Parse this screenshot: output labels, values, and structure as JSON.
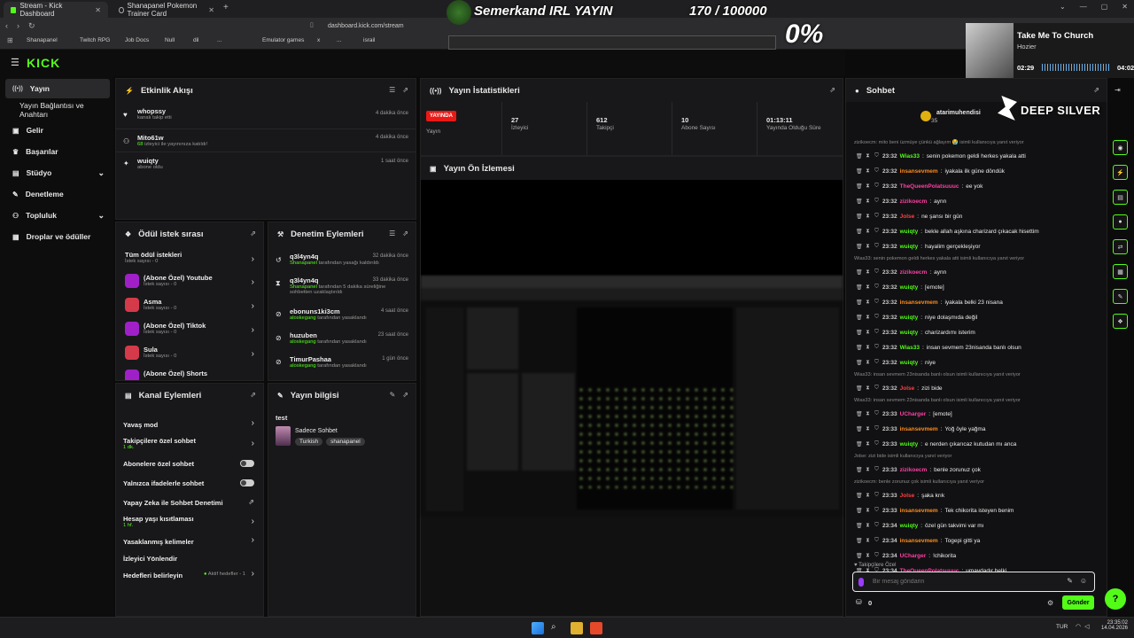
{
  "browser": {
    "tabs": [
      {
        "label": "Stream - Kick Dashboard"
      },
      {
        "label": "Shanapanel Pokemon Trainer Card"
      }
    ],
    "url": "dashboard.kick.com/stream",
    "bookmarks": [
      "Shanapanel",
      "Twitch RPG",
      "Job Docs",
      "Null",
      "dil",
      "...",
      "",
      "Emulator games",
      "x",
      "...",
      "israil"
    ]
  },
  "overlay": {
    "stream_title": "Semerkand IRL YAYIN",
    "goal": "170 / 100000",
    "percent": "0%",
    "sponsor": "DEEP SILVER",
    "music": {
      "title": "Take Me To Church",
      "artist": "Hozier",
      "elapsed": "02:29",
      "total": "04:02"
    }
  },
  "app": {
    "logo": "KICK",
    "sidebar": [
      {
        "label": "Yayın",
        "icon": "broadcast-icon"
      },
      {
        "label": "Yayın Bağlantısı ve Anahtarı",
        "icon": ""
      },
      {
        "label": "Gelir",
        "icon": "money-icon"
      },
      {
        "label": "Başarılar",
        "icon": "trophy-icon"
      },
      {
        "label": "Stüdyo",
        "icon": "studio-icon"
      },
      {
        "label": "Denetleme",
        "icon": "wrench-icon"
      },
      {
        "label": "Topluluk",
        "icon": "community-icon"
      },
      {
        "label": "Droplar ve ödüller",
        "icon": "gift-icon"
      }
    ]
  },
  "activity": {
    "title": "Etkinlik Akışı",
    "items": [
      {
        "name": "whopssy",
        "desc": "kanalı takip etti",
        "time": "4 dakika önce"
      },
      {
        "name": "Mito61w",
        "count": "68",
        "desc": " izleyici ile yayınınıza katıldı!",
        "time": "4 dakika önce"
      },
      {
        "name": "wuiqty",
        "desc": "abone oldu",
        "time": "1 saat önce"
      }
    ]
  },
  "stats": {
    "title": "Yayın İstatistikleri",
    "live_badge": "YAYINDA",
    "live_label": "Yayın",
    "cells": [
      {
        "value": "27",
        "label": "İzleyici"
      },
      {
        "value": "612",
        "label": "Takipçi"
      },
      {
        "value": "10",
        "label": "Abone Sayısı"
      },
      {
        "value": "01:13:11",
        "label": "Yayında Olduğu Süre"
      }
    ]
  },
  "preview": {
    "title": "Yayın Ön İzlemesi"
  },
  "rewards": {
    "title": "Ödül istek sırası",
    "all": {
      "title": "Tüm ödül istekleri",
      "sub": "İstek sayısı - 0"
    },
    "items": [
      {
        "title": "(Abone Özel) Youtube",
        "sub": "İstek sayısı - 0"
      },
      {
        "title": "Asma",
        "sub": "İstek sayısı - 0"
      },
      {
        "title": "(Abone Özel) Tiktok",
        "sub": "İstek sayısı - 0"
      },
      {
        "title": "Sula",
        "sub": "İstek sayısı - 0"
      },
      {
        "title": "(Abone Özel) Shorts",
        "sub": ""
      }
    ]
  },
  "moderation": {
    "title": "Denetim Eylemleri",
    "items": [
      {
        "name": "q3l4yn4q",
        "actor": "Shanapanel",
        "action": " tarafından yasağı kaldırıldı",
        "time": "32 dakika önce"
      },
      {
        "name": "q3l4yn4q",
        "actor": "Shanapanel",
        "action": " tarafından 5 dakika süreliğine sohbetten uzaklaştırıldı",
        "time": "33 dakika önce"
      },
      {
        "name": "ebonuns1ki3cm",
        "actor": "aloskegang",
        "action": " tarafından yasaklandı",
        "time": "4 saat önce"
      },
      {
        "name": "huzuben",
        "actor": "aloskegang",
        "action": " tarafından yasaklandı",
        "time": "23 saat önce"
      },
      {
        "name": "TimurPashaa",
        "actor": "aloskegang",
        "action": " tarafından yasaklandı",
        "time": "1 gün önce"
      }
    ]
  },
  "channel": {
    "title": "Kanal Eylemleri",
    "items": [
      {
        "label": "Yavaş mod",
        "sub": "",
        "control": "chevron"
      },
      {
        "label": "Takipçilere özel sohbet",
        "sub": "1 dk.",
        "control": "chevron"
      },
      {
        "label": "Abonelere özel sohbet",
        "sub": "",
        "control": "toggle"
      },
      {
        "label": "Yalnızca ifadelerle sohbet",
        "sub": "",
        "control": "toggle"
      },
      {
        "label": "Yapay Zeka ile Sohbet Denetimi",
        "sub": "",
        "control": "external"
      },
      {
        "label": "Hesap yaşı kısıtlaması",
        "sub": "1 hf.",
        "control": "chevron"
      },
      {
        "label": "Yasaklanmış kelimeler",
        "sub": "",
        "control": "chevron"
      },
      {
        "label": "İzleyici Yönlendir",
        "sub": "",
        "control": "none"
      },
      {
        "label": "Hedefleri belirleyin",
        "sub": "Aktif hedefler - 1",
        "control": "chevron"
      }
    ]
  },
  "info": {
    "title": "Yayın bilgisi",
    "stream_name": "test",
    "category": "Sadece Sohbet",
    "tags": [
      "Turkish",
      "shanapanel"
    ]
  },
  "chat": {
    "title": "Sohbet",
    "pinned_user": "atarimuhendisi",
    "pinned_count": "35",
    "lines": [
      {
        "type": "reply",
        "text": "zizikoecm: mito beni üzmüye çünkü ağlayım 😭 isimli kullanıcıya yanıt veriyor"
      },
      {
        "type": "msg",
        "time": "23:32",
        "user": "Wias33",
        "color": "#53fc18",
        "text": "senin pokemon geldi herkes yakala atti"
      },
      {
        "type": "msg",
        "time": "23:32",
        "user": "insansevmem",
        "color": "#ff8c1a",
        "text": "iyakala ilk güne döndük"
      },
      {
        "type": "msg",
        "time": "23:32",
        "user": "TheQueenPolatsuuuc",
        "color": "#ff3fa4",
        "text": "ee yok"
      },
      {
        "type": "msg",
        "time": "23:32",
        "user": "zizikoecm",
        "color": "#ff3fa4",
        "text": "aynn"
      },
      {
        "type": "msg",
        "time": "23:32",
        "user": "Jolse",
        "color": "#ff4040",
        "text": "ne şansı bir gün"
      },
      {
        "type": "msg",
        "time": "23:32",
        "user": "wuiqty",
        "color": "#53fc18",
        "text": "bekle allah aşkına charizard çıkacak hisettim"
      },
      {
        "type": "msg",
        "time": "23:32",
        "user": "wuiqty",
        "color": "#53fc18",
        "text": "hayalim gerçekleşiyor"
      },
      {
        "type": "reply",
        "text": "Wias33: senin pokemon geldi herkes yakala atti isimli kullanıcıya yanıt veriyor"
      },
      {
        "type": "msg",
        "time": "23:32",
        "user": "zizikoecm",
        "color": "#ff3fa4",
        "text": "aynn"
      },
      {
        "type": "msg",
        "time": "23:32",
        "user": "wuiqty",
        "color": "#53fc18",
        "text": "[emote]"
      },
      {
        "type": "msg",
        "time": "23:32",
        "user": "insansevmem",
        "color": "#ff8c1a",
        "text": "iyakala belki 23 nisana"
      },
      {
        "type": "msg",
        "time": "23:32",
        "user": "wuiqty",
        "color": "#53fc18",
        "text": "niye dolaşmıda değil"
      },
      {
        "type": "msg",
        "time": "23:32",
        "user": "wuiqty",
        "color": "#53fc18",
        "text": "charizardımı isterim"
      },
      {
        "type": "msg",
        "time": "23:32",
        "user": "Wias33",
        "color": "#53fc18",
        "text": "insan sevmem 23nisanda banlı olsun"
      },
      {
        "type": "msg",
        "time": "23:32",
        "user": "wuiqty",
        "color": "#53fc18",
        "text": "niye"
      },
      {
        "type": "reply",
        "text": "Wias33: insan sevmem 23nisanda banlı olsun isimli kullanıcıya yanıt veriyor"
      },
      {
        "type": "msg",
        "time": "23:32",
        "user": "Jolse",
        "color": "#ff4040",
        "text": "zizi bide"
      },
      {
        "type": "reply",
        "text": "Wias33: insan sevmem 23nisanda banlı olsun isimli kullanıcıya yanıt veriyor"
      },
      {
        "type": "msg",
        "time": "23:33",
        "user": "UCharger",
        "color": "#ff3fa4",
        "text": "[emote]"
      },
      {
        "type": "msg",
        "time": "23:33",
        "user": "insansevmem",
        "color": "#ff8c1a",
        "text": "Yoğ öyle yağma"
      },
      {
        "type": "msg",
        "time": "23:33",
        "user": "wuiqty",
        "color": "#53fc18",
        "text": "e nerden çıkarıcaz kutudan mı anca"
      },
      {
        "type": "reply",
        "text": "Jolse: zizi bide isimli kullanıcıya yanıt veriyor"
      },
      {
        "type": "msg",
        "time": "23:33",
        "user": "zizikoecm",
        "color": "#ff3fa4",
        "text": "benle zorunuz çok"
      },
      {
        "type": "reply",
        "text": "zizikoecm: benle zorunuz çok isimli kullanıcıya yanıt veriyor"
      },
      {
        "type": "msg",
        "time": "23:33",
        "user": "Jolse",
        "color": "#ff4040",
        "text": "şaka krık"
      },
      {
        "type": "msg",
        "time": "23:33",
        "user": "insansevmem",
        "color": "#ff8c1a",
        "text": "Tek chikorita isteyen benim"
      },
      {
        "type": "msg",
        "time": "23:34",
        "user": "wuiqty",
        "color": "#53fc18",
        "text": "özel gün takvimi var mı"
      },
      {
        "type": "msg",
        "time": "23:34",
        "user": "insansevmem",
        "color": "#ff8c1a",
        "text": "Togepi gitti ya"
      },
      {
        "type": "msg",
        "time": "23:34",
        "user": "UCharger",
        "color": "#ff3fa4",
        "text": "!chikorita"
      },
      {
        "type": "msg",
        "time": "23:34",
        "user": "TheQueenPolatsuuuc",
        "color": "#ff3fa4",
        "text": "umaydadır belki"
      }
    ],
    "mode": "Takipçilere Özel",
    "input_placeholder": "Bir mesaj göndarin",
    "points": "0",
    "send": "Gönder"
  },
  "taskbar": {
    "lang": "TUR",
    "time": "23:35:02",
    "date": "14.04.2026"
  },
  "colors": {
    "accent": "#53fc18",
    "live": "#e91916",
    "panel": "#18181a"
  }
}
